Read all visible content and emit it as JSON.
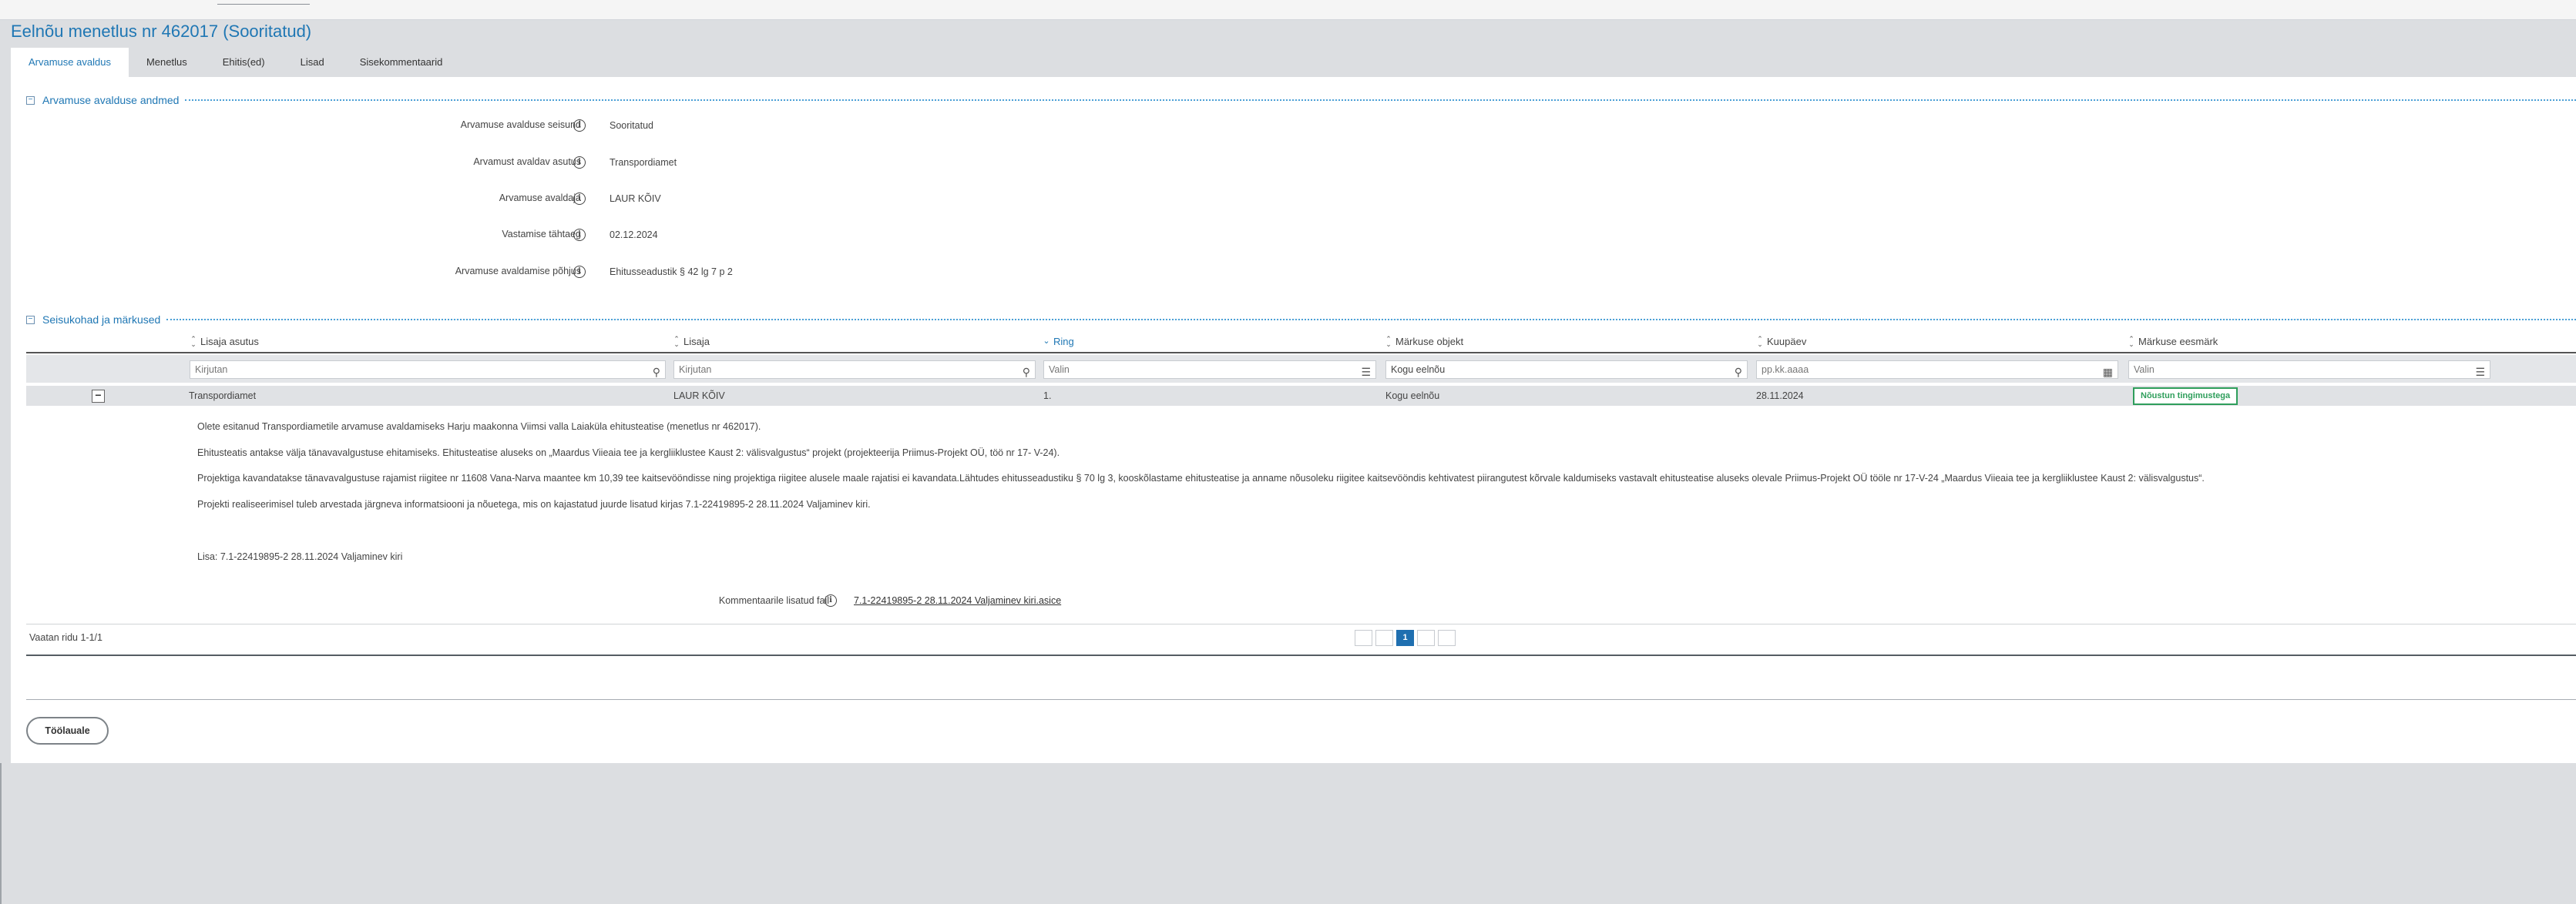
{
  "page": {
    "title": "Eelnõu menetlus nr 462017 (Sooritatud)"
  },
  "tabs": [
    {
      "label": "Arvamuse avaldus"
    },
    {
      "label": "Menetlus"
    },
    {
      "label": "Ehitis(ed)"
    },
    {
      "label": "Lisad"
    },
    {
      "label": "Sisekommentaarid"
    }
  ],
  "details_section": {
    "title": "Arvamuse avalduse andmed",
    "fields": [
      {
        "label": "Arvamuse avalduse seisund",
        "value": "Sooritatud"
      },
      {
        "label": "Arvamust avaldav asutus",
        "value": "Transpordiamet"
      },
      {
        "label": "Arvamuse avaldaja",
        "value": "LAUR KÕIV"
      },
      {
        "label": "Vastamise tähtaeg",
        "value": "02.12.2024"
      },
      {
        "label": "Arvamuse avaldamise põhjus",
        "value": "Ehitusseadustik § 42 lg 7 p 2"
      }
    ]
  },
  "comments_section": {
    "title": "Seisukohad ja märkused",
    "columns": [
      {
        "label": "Lisaja asutus"
      },
      {
        "label": "Lisaja"
      },
      {
        "label": "Ring"
      },
      {
        "label": "Märkuse objekt"
      },
      {
        "label": "Kuupäev"
      },
      {
        "label": "Märkuse eesmärk"
      }
    ],
    "filters": {
      "asutus_placeholder": "Kirjutan",
      "lisaja_placeholder": "Kirjutan",
      "ring_placeholder": "Valin",
      "objekt_value": "Kogu eelnõu",
      "kuupaev_placeholder": "pp.kk.aaaa",
      "eesmark_placeholder": "Valin"
    },
    "row": {
      "asutus": "Transpordiamet",
      "lisaja": "LAUR KÕIV",
      "ring": "1.",
      "objekt": "Kogu eelnõu",
      "kuupaev": "28.11.2024",
      "eesmark": "Nõustun tingimustega"
    },
    "detail_text": [
      "Olete esitanud Transpordiametile arvamuse avaldamiseks Harju maakonna Viimsi valla Laiaküla ehitusteatise (menetlus nr 462017).",
      "Ehitusteatis antakse välja tänavavalgustuse ehitamiseks. Ehitusteatise aluseks on „Maardus Viieaia tee ja kergliiklustee Kaust 2: välisvalgustus“ projekt (projekteerija Priimus-Projekt OÜ, töö nr 17- V-24).",
      "Projektiga kavandatakse tänavavalgustuse rajamist riigitee nr 11608 Vana-Narva maantee km 10,39 tee kaitsevööndisse ning projektiga riigitee alusele maale rajatisi ei kavandata.Lähtudes ehitusseadustiku § 70 lg 3, kooskõlastame ehitusteatise ja anname nõusoleku riigitee kaitsevööndis kehtivatest piirangutest kõrvale kaldumiseks vastavalt ehitusteatise aluseks olevale Priimus-Projekt OÜ tööle nr 17-V-24 „Maardus Viieaia tee ja kergliiklustee Kaust 2: välisvalgustus“.",
      "Projekti realiseerimisel tuleb arvestada järgneva informatsiooni ja nõuetega, mis on kajastatud juurde lisatud kirjas 7.1-22419895-2 28.11.2024 Valjaminev kiri.",
      "Lisa: 7.1-22419895-2 28.11.2024 Valjaminev kiri"
    ],
    "attachment": {
      "label": "Kommentaarile lisatud fail",
      "file": "7.1-22419895-2 28.11.2024 Valjaminev kiri.asice"
    },
    "rows_info": "Vaatan ridu 1-1/1",
    "pager": {
      "current_page": "1"
    }
  },
  "actions": {
    "back_label": "Töölauale"
  }
}
